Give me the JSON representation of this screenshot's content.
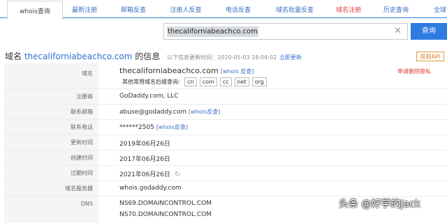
{
  "tabs": [
    "whois查询",
    "最新注册",
    "邮箱反查",
    "注册人反查",
    "电话反查",
    "域名批量反查",
    "域名注册",
    "历史查询",
    "全球"
  ],
  "search": {
    "value": "thecaliforniabeachco.com",
    "button": "查询"
  },
  "headline": {
    "prefix": "域名",
    "domain": "thecaliforniabeachco.com",
    "suffix": "的信息",
    "meta": "以下信息更新时间：2020-05-03 18:04:02",
    "update": "立即更新",
    "api": "获取API"
  },
  "rows": {
    "domain": {
      "label": "域名",
      "value": "thecaliforniabeachco.com",
      "link": "[whois 反查]",
      "privacy": "申请删除隐私",
      "suffix_label": "其他常用域名后缀查询:",
      "suffixes": [
        "cn",
        "com",
        "cc",
        "net",
        "org"
      ]
    },
    "registrar": {
      "label": "注册商",
      "value": "GoDaddy.com, LLC"
    },
    "email": {
      "label": "联系邮箱",
      "value": "abuse@godaddy.com",
      "link": "[whois反查]"
    },
    "phone": {
      "label": "联系电话",
      "value": "******2505",
      "link": "[whois反查]"
    },
    "updated": {
      "label": "更新时间",
      "value": "2019年06月26日"
    },
    "created": {
      "label": "创建时间",
      "value": "2017年06月26日"
    },
    "expires": {
      "label": "过期时间",
      "value": "2021年06月26日"
    },
    "server": {
      "label": "域名服务器",
      "value": "whois.godaddy.com"
    },
    "dns": {
      "label": "DNS",
      "values": [
        "NS69.DOMAINCONTROL.COM",
        "NS70.DOMAINCONTROL.COM"
      ]
    }
  },
  "watermark": "头条 @好学的Jack",
  "colors": {
    "accent": "#2f7ce0",
    "alert": "#e23c3c"
  }
}
